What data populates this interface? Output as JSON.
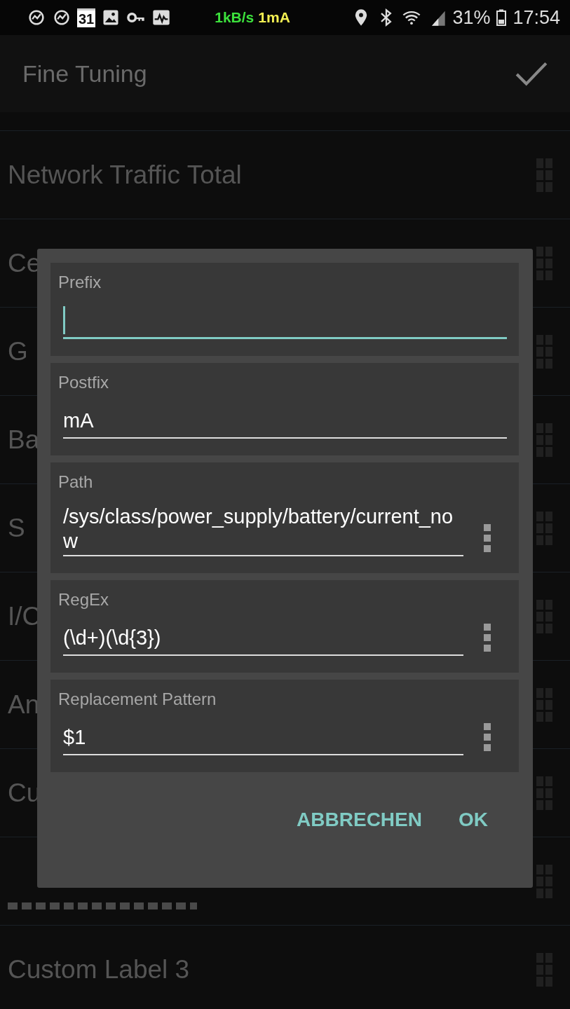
{
  "status_bar": {
    "calendar_day": "31",
    "net_speed": "1kB/s",
    "current": "1mA",
    "battery": "31%",
    "time": "17:54"
  },
  "header": {
    "title": "Fine Tuning"
  },
  "list": [
    {
      "label": "Network Traffic Total"
    },
    {
      "label": "Ce"
    },
    {
      "label": "G"
    },
    {
      "label": "Ba"
    },
    {
      "label": "S"
    },
    {
      "label": "I/C"
    },
    {
      "label": "An"
    },
    {
      "label": "Cu"
    },
    {
      "kind": "covered"
    },
    {
      "label": "Custom Label 3"
    }
  ],
  "dialog": {
    "fields": [
      {
        "label": "Prefix",
        "focused": true,
        "has_menu": false
      },
      {
        "label": "Postfix",
        "value": "mA",
        "focused": false,
        "has_menu": false
      },
      {
        "label": "Path",
        "value": "/sys/class/power_supply/battery/current_now",
        "focused": false,
        "has_menu": true
      },
      {
        "label": "RegEx",
        "value": "(\\d+)(\\d{3})",
        "focused": false,
        "has_menu": true
      },
      {
        "label": "Replacement Pattern",
        "value": "$1",
        "focused": false,
        "has_menu": true
      }
    ],
    "buttons": [
      "ABBRECHEN",
      "OK"
    ]
  }
}
